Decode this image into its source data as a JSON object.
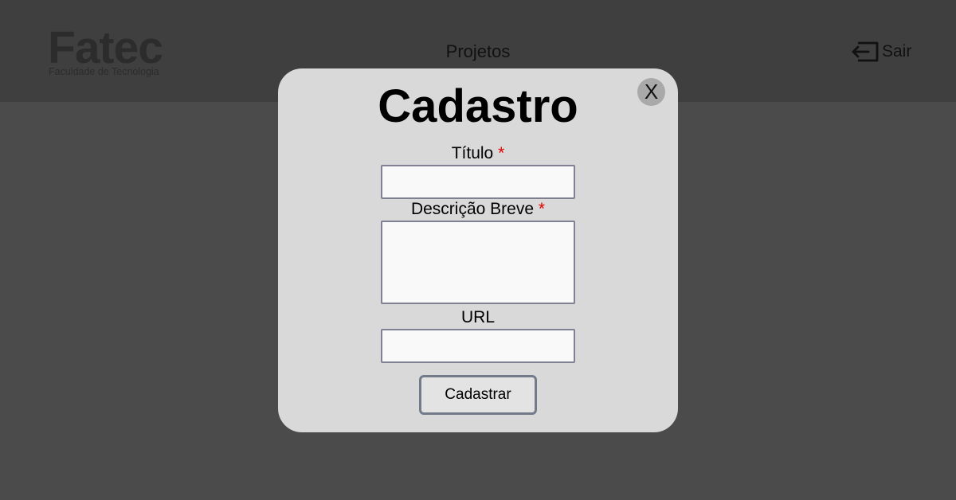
{
  "header": {
    "logo_text": "Fatec",
    "logo_subtitle": "Faculdade de Tecnologia",
    "nav_projetos": "Projetos",
    "logout_label": "Sair",
    "logout_icon": "logout-arrow-icon"
  },
  "modal": {
    "title": "Cadastro",
    "close_label": "X",
    "fields": [
      {
        "label": "Título",
        "required_mark": "*",
        "value": "",
        "placeholder": ""
      },
      {
        "label": "Descrição Breve",
        "required_mark": "*",
        "value": "",
        "placeholder": ""
      },
      {
        "label": "URL",
        "value": "",
        "placeholder": ""
      }
    ],
    "submit_label": "Cadastrar"
  },
  "colors": {
    "overlay": "#4b4b4b",
    "header": "#3f3f3f",
    "modal": "#d9d9d9",
    "required": "#e00000"
  }
}
